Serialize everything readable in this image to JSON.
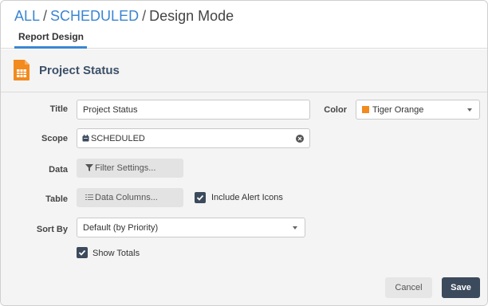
{
  "breadcrumb": {
    "all": "ALL",
    "sep1": "/",
    "scheduled": "SCHEDULED",
    "sep2": "/",
    "current": "Design Mode"
  },
  "tabs": [
    {
      "label": "Report Design",
      "active": true
    }
  ],
  "panel": {
    "title": "Project Status",
    "icon": "spreadsheet-file-icon",
    "icon_color": "#f28a1e"
  },
  "form": {
    "title_label": "Title",
    "title_value": "Project Status",
    "color_label": "Color",
    "color_value": "Tiger Orange",
    "color_hex": "#f28a1e",
    "scope_label": "Scope",
    "scope_value": "SCHEDULED",
    "data_label": "Data",
    "filter_button": "Filter Settings...",
    "table_label": "Table",
    "columns_button": "Data Columns...",
    "include_alert_icons_label": "Include Alert Icons",
    "include_alert_icons_checked": true,
    "sort_label": "Sort By",
    "sort_value": "Default (by Priority)",
    "show_totals_label": "Show Totals",
    "show_totals_checked": true
  },
  "actions": {
    "cancel": "Cancel",
    "save": "Save"
  },
  "colors": {
    "accent_blue": "#3a86d1",
    "primary_button": "#3b4a5c"
  }
}
